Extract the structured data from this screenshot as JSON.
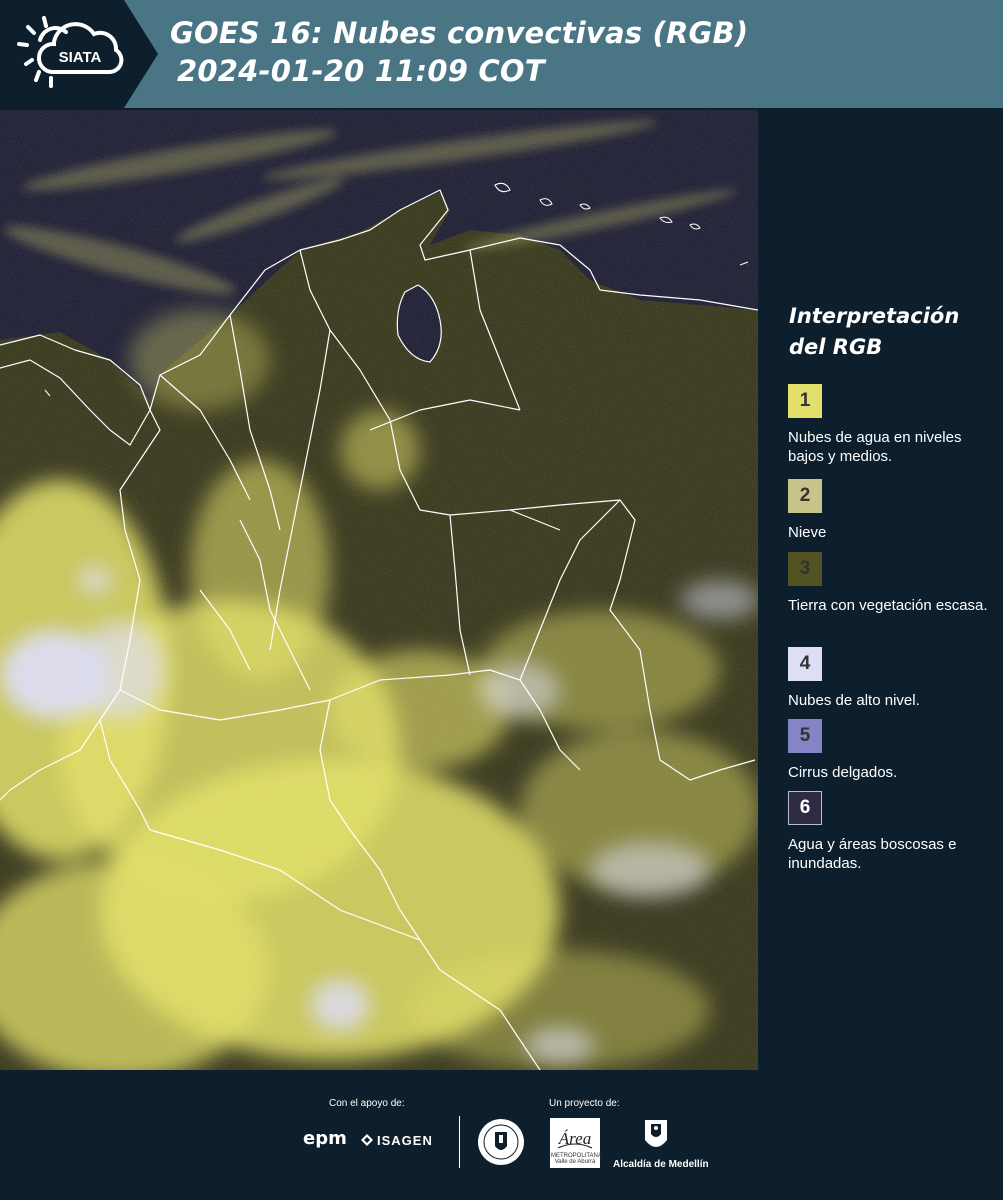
{
  "header": {
    "logo_text": "SIATA",
    "title_line1": "GOES 16: Nubes convectivas (RGB)",
    "title_line2": "2024-01-20 11:09 COT",
    "background_color": "#4a7585",
    "logo_background_color": "#0d1f2c"
  },
  "map": {
    "type": "satellite-rgb-composite",
    "product": "Nubes convectivas (RGB)",
    "region": "Colombia",
    "colors": {
      "dark_background": "#22223a",
      "vegetation": "#4a4a1c",
      "low_cloud": "#e3e06a",
      "high_cloud": "#d8d8ee",
      "borders": "#ffffff"
    }
  },
  "legend": {
    "title": "Interpretación del RGB",
    "items": [
      {
        "number": "1",
        "label": "Nubes de agua en niveles bajos y medios.",
        "color": "#e2e06a"
      },
      {
        "number": "2",
        "label": "Nieve",
        "color": "#c8c489"
      },
      {
        "number": "3",
        "label": "Tierra con vegetación escasa.",
        "color": "#525223"
      },
      {
        "number": "4",
        "label": "Nubes de alto nivel.",
        "color": "#dedef6"
      },
      {
        "number": "5",
        "label": "Cirrus delgados.",
        "color": "#8484c6"
      },
      {
        "number": "6",
        "label": "Agua y áreas boscosas e inundadas.",
        "color": "#2e2c44"
      }
    ]
  },
  "footer": {
    "support_label": "Con el apoyo de:",
    "project_label": "Un proyecto de:",
    "logos": [
      "epm",
      "ISAGEN",
      "Alcaldía de Medellín"
    ],
    "amva_name": "Área",
    "amva_sub": "METROPOLITANA Valle de Aburrá"
  }
}
